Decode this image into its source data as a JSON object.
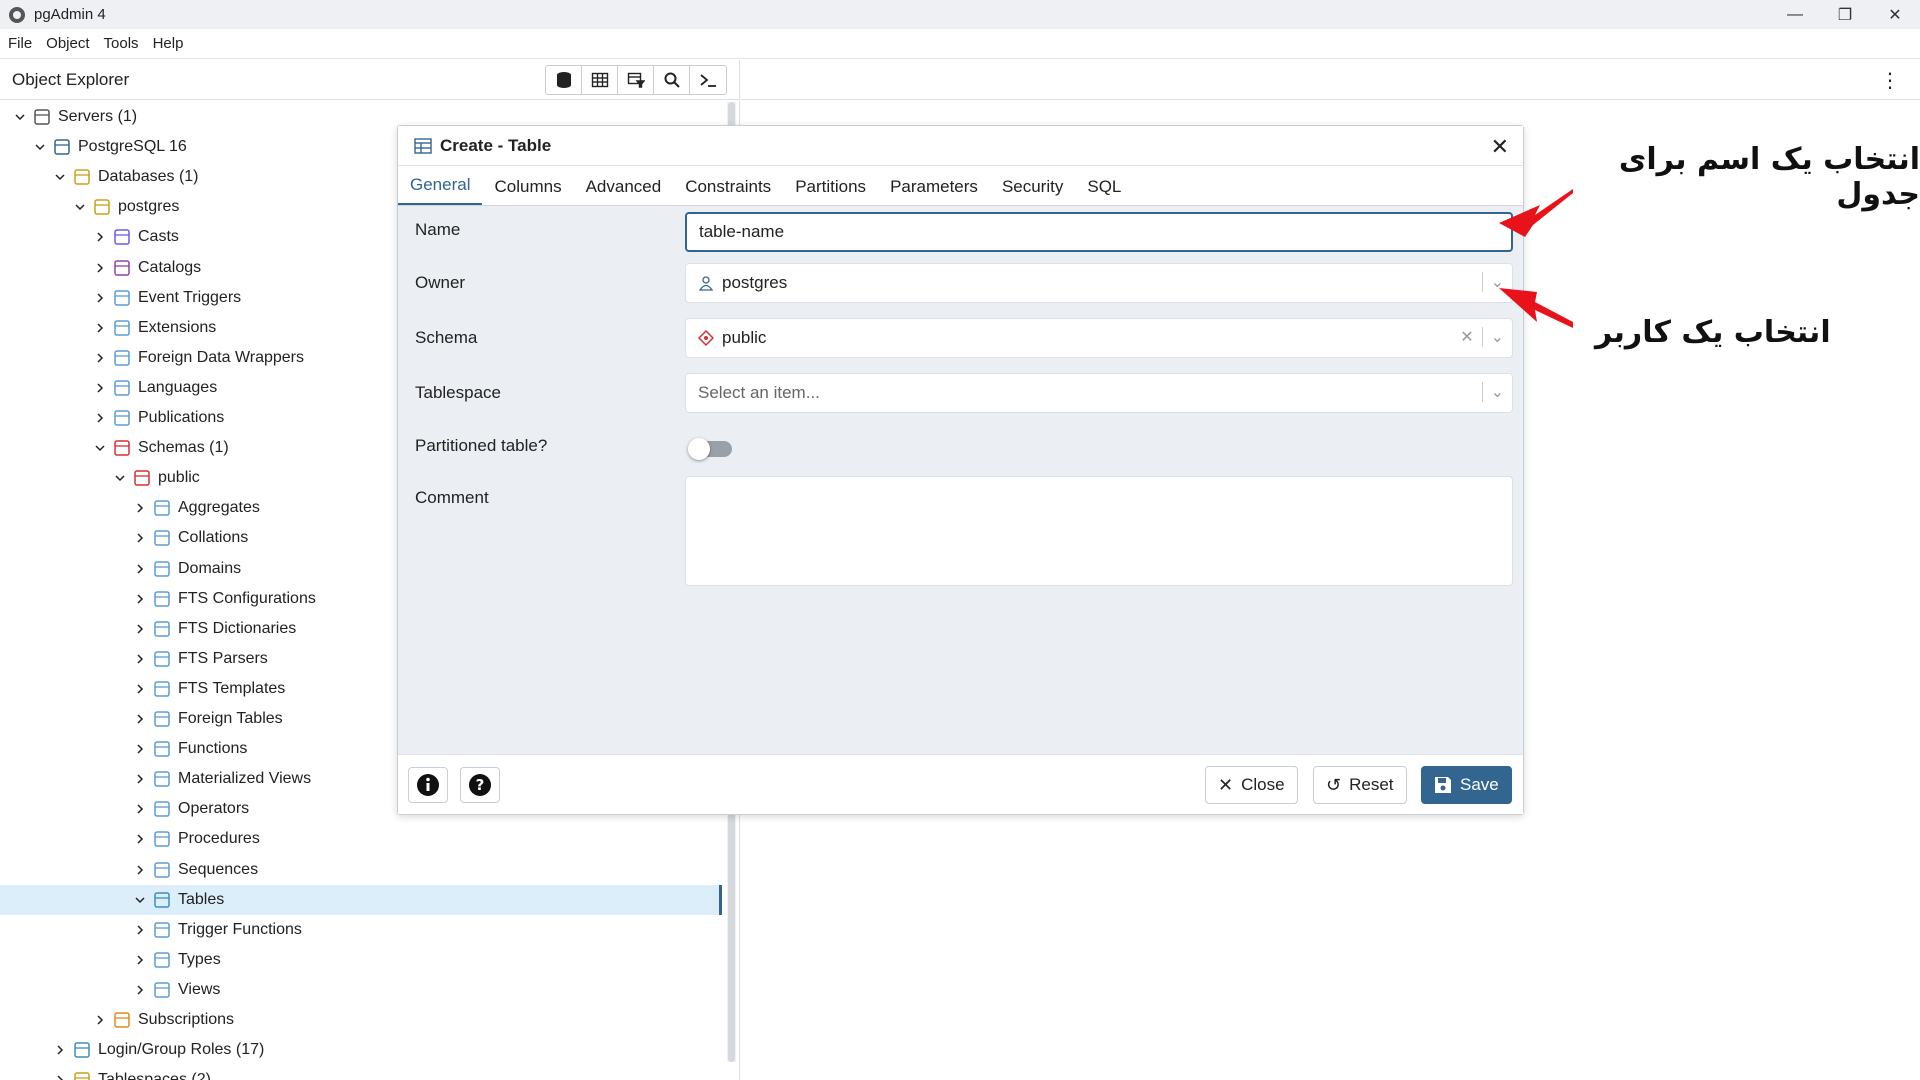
{
  "window": {
    "title": "pgAdmin 4",
    "min": "—",
    "max": "❐",
    "close": "✕"
  },
  "menu": [
    "File",
    "Object",
    "Tools",
    "Help"
  ],
  "explorer": {
    "title": "Object Explorer",
    "tree": [
      {
        "label": "Servers (1)",
        "depth": 0,
        "chev": "open",
        "icon": "servers-icon"
      },
      {
        "label": "PostgreSQL 16",
        "depth": 1,
        "chev": "open",
        "icon": "elephant-icon"
      },
      {
        "label": "Databases (1)",
        "depth": 2,
        "chev": "open",
        "icon": "databases-icon"
      },
      {
        "label": "postgres",
        "depth": 3,
        "chev": "open",
        "icon": "database-icon"
      },
      {
        "label": "Casts",
        "depth": 4,
        "chev": "closed",
        "icon": "casts-icon"
      },
      {
        "label": "Catalogs",
        "depth": 4,
        "chev": "closed",
        "icon": "catalogs-icon"
      },
      {
        "label": "Event Triggers",
        "depth": 4,
        "chev": "closed",
        "icon": "event-triggers-icon"
      },
      {
        "label": "Extensions",
        "depth": 4,
        "chev": "closed",
        "icon": "extensions-icon"
      },
      {
        "label": "Foreign Data Wrappers",
        "depth": 4,
        "chev": "closed",
        "icon": "fdw-icon"
      },
      {
        "label": "Languages",
        "depth": 4,
        "chev": "closed",
        "icon": "languages-icon"
      },
      {
        "label": "Publications",
        "depth": 4,
        "chev": "closed",
        "icon": "publications-icon"
      },
      {
        "label": "Schemas (1)",
        "depth": 4,
        "chev": "open",
        "icon": "schemas-icon"
      },
      {
        "label": "public",
        "depth": 5,
        "chev": "open",
        "icon": "schema-icon"
      },
      {
        "label": "Aggregates",
        "depth": 6,
        "chev": "closed",
        "icon": "aggregates-icon"
      },
      {
        "label": "Collations",
        "depth": 6,
        "chev": "closed",
        "icon": "collations-icon"
      },
      {
        "label": "Domains",
        "depth": 6,
        "chev": "closed",
        "icon": "domains-icon"
      },
      {
        "label": "FTS Configurations",
        "depth": 6,
        "chev": "closed",
        "icon": "fts-config-icon"
      },
      {
        "label": "FTS Dictionaries",
        "depth": 6,
        "chev": "closed",
        "icon": "fts-dict-icon"
      },
      {
        "label": "FTS Parsers",
        "depth": 6,
        "chev": "closed",
        "icon": "fts-parsers-icon"
      },
      {
        "label": "FTS Templates",
        "depth": 6,
        "chev": "closed",
        "icon": "fts-templates-icon"
      },
      {
        "label": "Foreign Tables",
        "depth": 6,
        "chev": "closed",
        "icon": "foreign-tables-icon"
      },
      {
        "label": "Functions",
        "depth": 6,
        "chev": "closed",
        "icon": "functions-icon"
      },
      {
        "label": "Materialized Views",
        "depth": 6,
        "chev": "closed",
        "icon": "mviews-icon"
      },
      {
        "label": "Operators",
        "depth": 6,
        "chev": "closed",
        "icon": "operators-icon"
      },
      {
        "label": "Procedures",
        "depth": 6,
        "chev": "closed",
        "icon": "procedures-icon"
      },
      {
        "label": "Sequences",
        "depth": 6,
        "chev": "closed",
        "icon": "sequences-icon"
      },
      {
        "label": "Tables",
        "depth": 6,
        "chev": "open",
        "icon": "tables-icon",
        "selected": true
      },
      {
        "label": "Trigger Functions",
        "depth": 6,
        "chev": "closed",
        "icon": "trigger-functions-icon"
      },
      {
        "label": "Types",
        "depth": 6,
        "chev": "closed",
        "icon": "types-icon"
      },
      {
        "label": "Views",
        "depth": 6,
        "chev": "closed",
        "icon": "views-icon"
      },
      {
        "label": "Subscriptions",
        "depth": 4,
        "chev": "closed",
        "icon": "subscriptions-icon"
      },
      {
        "label": "Login/Group Roles (17)",
        "depth": 2,
        "chev": "closed",
        "icon": "roles-icon"
      },
      {
        "label": "Tablespaces (2)",
        "depth": 2,
        "chev": "closed",
        "icon": "tablespaces-icon"
      }
    ]
  },
  "dialog": {
    "title": "Create - Table",
    "tabs": [
      "General",
      "Columns",
      "Advanced",
      "Constraints",
      "Partitions",
      "Parameters",
      "Security",
      "SQL"
    ],
    "active_tab": "General",
    "fields": {
      "name_label": "Name",
      "name_value": "table-name",
      "owner_label": "Owner",
      "owner_value": "postgres",
      "schema_label": "Schema",
      "schema_value": "public",
      "tablespace_label": "Tablespace",
      "tablespace_placeholder": "Select an item...",
      "partitioned_label": "Partitioned table?",
      "partitioned_on": false,
      "comment_label": "Comment"
    },
    "footer": {
      "close": "Close",
      "reset": "Reset",
      "save": "Save"
    }
  },
  "annotations": {
    "name_hint": "انتخاب یک اسم برای جدول",
    "owner_hint": "انتخاب یک کاربر"
  },
  "colors": {
    "accent": "#326690",
    "arrow": "#e8121b",
    "selected_row": "#dbeefa"
  }
}
